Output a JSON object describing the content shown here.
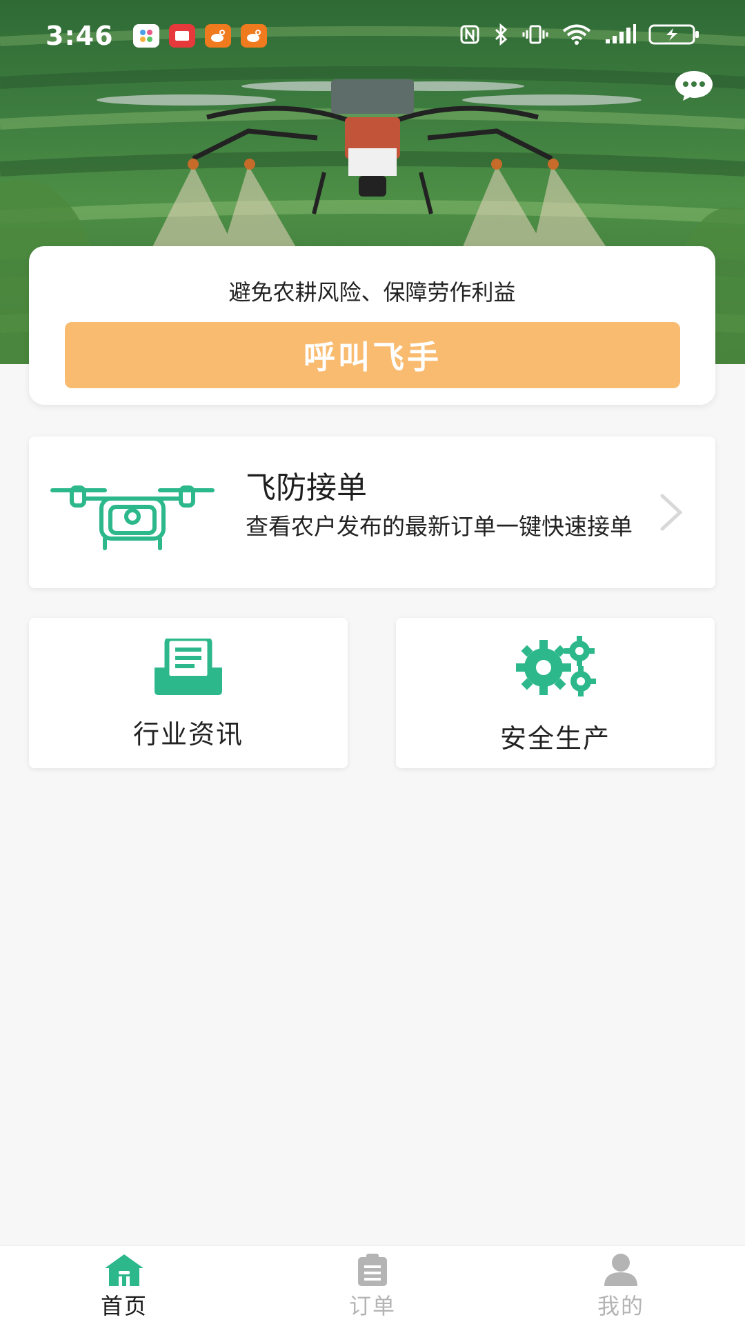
{
  "status_bar": {
    "time": "3:46",
    "icons": [
      "gallery-app-icon",
      "reader-app-icon",
      "weibo-app-icon",
      "weibo-app-icon",
      "nfc-icon",
      "bluetooth-icon",
      "vibrate-icon",
      "wifi-icon",
      "signal-icon",
      "battery-charging-icon"
    ]
  },
  "hero": {
    "image": "agricultural spraying drone over crop field"
  },
  "call_card": {
    "slogan": "避免农耕风险、保障劳作利益",
    "button_label": "呼叫飞手",
    "button_color": "#f8bb6f"
  },
  "order_card": {
    "title": "飞防接单",
    "description": "查看农户发布的最新订单一键快速接单"
  },
  "tiles": {
    "news_label": "行业资讯",
    "safety_label": "安全生产"
  },
  "bottom_nav": {
    "home_label": "首页",
    "orders_label": "订单",
    "mine_label": "我的",
    "active_color": "#2cb88a",
    "inactive_color": "#b4b4b4"
  },
  "colors": {
    "accent_green": "#2cb88a",
    "page_bg": "#f7f7f7"
  }
}
